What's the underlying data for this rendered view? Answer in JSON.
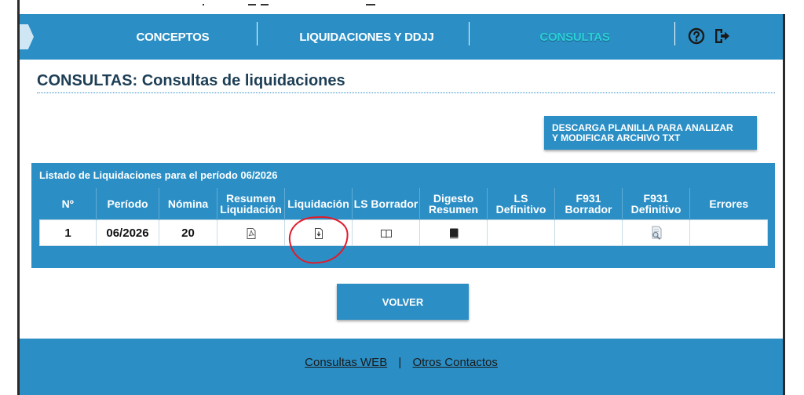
{
  "nav": {
    "items": [
      {
        "label": "CONCEPTOS",
        "active": false
      },
      {
        "label": "LIQUIDACIONES Y DDJJ",
        "active": false
      },
      {
        "label": "CONSULTAS",
        "active": true
      }
    ],
    "help_icon": "help-circle-icon",
    "logout_icon": "logout-icon"
  },
  "page": {
    "title": "CONSULTAS: Consultas de liquidaciones",
    "download_button": "DESCARGA PLANILLA PARA ANALIZAR Y MODIFICAR ARCHIVO TXT"
  },
  "listing": {
    "title": "Listado de Liquidaciones para el período 06/2026",
    "columns": [
      "Nº",
      "Período",
      "Nómina",
      "Resumen Liquidación",
      "Liquidación",
      "LS Borrador",
      "Digesto Resumen",
      "LS Definitivo",
      "F931 Borrador",
      "F931 Definitivo",
      "Errores"
    ],
    "rows": [
      {
        "numero": "1",
        "periodo": "06/2026",
        "nomina": "20"
      }
    ]
  },
  "back_button": "VOLVER",
  "footer": {
    "link1": "Consultas WEB",
    "separator": "|",
    "link2": "Otros Contactos"
  },
  "colors": {
    "accent": "#2b8fc6",
    "active_nav": "#2bd0d6",
    "annotation": "#e21b2a"
  }
}
